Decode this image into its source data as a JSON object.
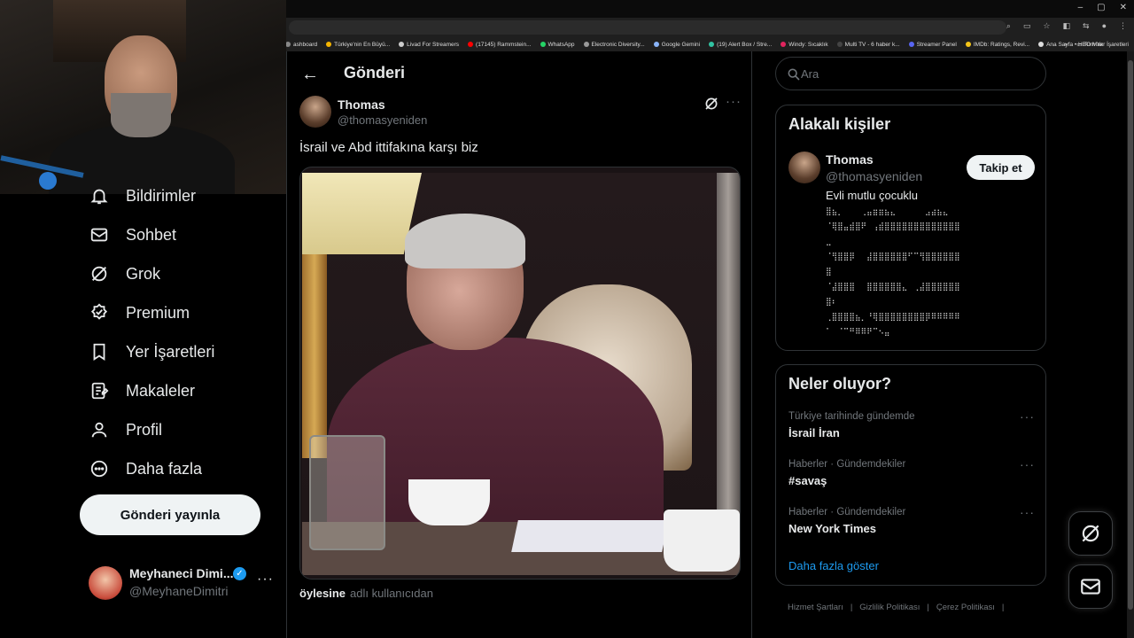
{
  "browser": {
    "window_controls": [
      "–",
      "▢",
      "✕"
    ],
    "bookmarks": [
      {
        "label": "ashboard",
        "color": "#888888"
      },
      {
        "label": "Türkiye'nin En Büyü...",
        "color": "#f5b400"
      },
      {
        "label": "Livad For Streamers",
        "color": "#cccccc"
      },
      {
        "label": "(17145) Rammstein...",
        "color": "#ff0000"
      },
      {
        "label": "WhatsApp",
        "color": "#25d366"
      },
      {
        "label": "Electronic Diversity...",
        "color": "#999999"
      },
      {
        "label": "Google Gemini",
        "color": "#8ab4f8"
      },
      {
        "label": "(19) Alert Box / Stre...",
        "color": "#31c3a2"
      },
      {
        "label": "Windy: Sıcaklık",
        "color": "#e0245e"
      },
      {
        "label": "Multi TV - 6 haber k...",
        "color": "#444444"
      },
      {
        "label": "Streamer Panel",
        "color": "#5865f2"
      },
      {
        "label": "IMDb: Ratings, Revi...",
        "color": "#f5c518"
      },
      {
        "label": "Ana Sayfa • HBO Max",
        "color": "#dddddd"
      }
    ],
    "bookmarks_more": "»",
    "all_bookmarks": "Tüm Yer İşaretleri"
  },
  "nav": {
    "items": [
      {
        "label": "Bildirimler",
        "icon": "bell-icon"
      },
      {
        "label": "Sohbet",
        "icon": "envelope-icon"
      },
      {
        "label": "Grok",
        "icon": "grok-icon"
      },
      {
        "label": "Premium",
        "icon": "premium-icon"
      },
      {
        "label": "Yer İşaretleri",
        "icon": "bookmark-icon"
      },
      {
        "label": "Makaleler",
        "icon": "article-icon"
      },
      {
        "label": "Profil",
        "icon": "person-icon"
      },
      {
        "label": "Daha fazla",
        "icon": "more-circle-icon"
      }
    ],
    "post_button": "Gönderi yayınla",
    "account": {
      "name": "Meyhaneci Dimi...",
      "handle": "@MeyhaneDimitri",
      "more": "···"
    }
  },
  "main": {
    "title": "Gönderi",
    "back_icon": "←",
    "author": {
      "name": "Thomas",
      "handle": "@thomasyeniden"
    },
    "more": "···",
    "text": "İsrail ve Abd ittifakına karşı biz",
    "caption_user": "öylesine",
    "caption_rest": "adlı kullanıcıdan"
  },
  "right": {
    "search_placeholder": "Ara",
    "related": {
      "title": "Alakalı kişiler",
      "name": "Thomas",
      "handle": "@thomasyeniden",
      "follow": "Takip et",
      "bio": "Evli mutlu çocuklu",
      "ascii_art": "⣿⣦⡀⠀⠀⠀⢀⣤⣶⣶⣦⣄⠀⠀⠀⠀⠀⣠⣴⣦⣄⠀\n⠈⢿⣿⣤⣾⣿⠟⠀⢠⣾⣿⣿⣿⣿⣿⣿⣿⣿⣿⣿⣿⣿⣿\n⣀\n⠈⢻⣿⣿⡿⠀⠀⣼⣿⣿⣿⣿⣿⣿⠋⠉⢻⣿⣿⣿⣿⣿⣿\n⣿\n⠈⣼⣿⣿⣿⠀⠀⣿⣿⣿⣿⣿⣿⣄⠀⢀⣼⣿⣿⣿⣿⣿⣿\n⣿⠆\n⢀⣿⣿⣿⣿⣦⡀⠘⢿⣿⣿⣿⣿⣿⣿⣿⣿⡿⠿⠿⠿⠿⠿\n⠁⠀⠈⠉⠛⠿⠿⠟⠉⠢⣤"
    },
    "trends": {
      "title": "Neler oluyor?",
      "items": [
        {
          "meta": "Türkiye tarihinde gündemde",
          "name": "İsrail İran"
        },
        {
          "meta": "Haberler · Gündemdekiler",
          "name": "#savaş"
        },
        {
          "meta": "Haberler · Gündemdekiler",
          "name": "New York Times"
        }
      ],
      "show_more": "Daha fazla göster"
    },
    "footer": [
      "Hizmet Şartları",
      "|",
      "Gizlilik Politikası",
      "|",
      "Çerez Politikası",
      "|"
    ]
  }
}
